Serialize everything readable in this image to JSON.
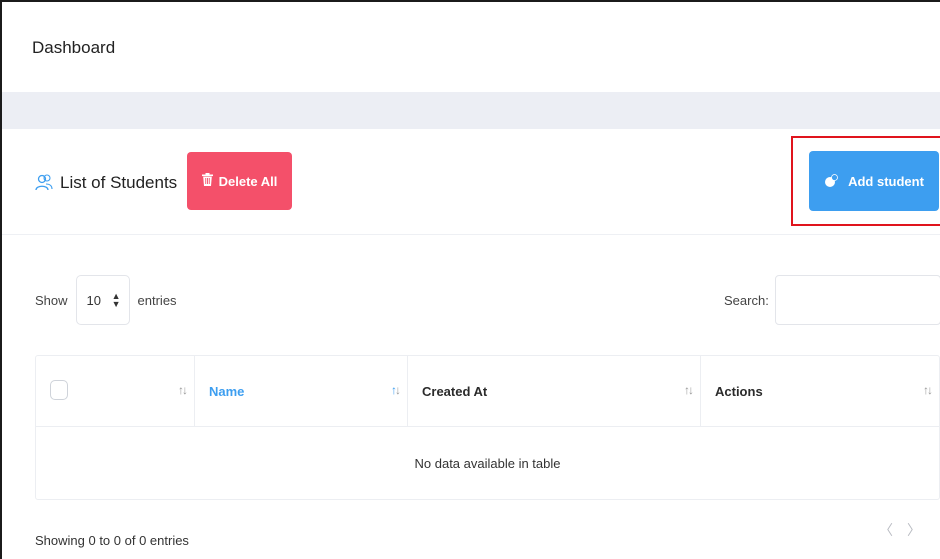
{
  "header": {
    "title": "Dashboard"
  },
  "card": {
    "title": "List of Students",
    "delete_all_label": "Delete All",
    "add_student_label": "Add student"
  },
  "length": {
    "show_label": "Show",
    "selected": "10",
    "entries_label": "entries"
  },
  "search": {
    "label": "Search:",
    "value": ""
  },
  "table": {
    "columns": [
      {
        "label": ""
      },
      {
        "label": "Name"
      },
      {
        "label": "Created At"
      },
      {
        "label": "Actions"
      }
    ],
    "sort_glyph": "↑↓",
    "empty_message": "No data available in table"
  },
  "footer": {
    "info": "Showing 0 to 0 of 0 entries",
    "prev_glyph": "〈",
    "next_glyph": "〉"
  },
  "colors": {
    "delete_button": "#f4506a",
    "add_button": "#3d9ef0",
    "highlight_box": "#e0141d",
    "active_sort": "#3d9ef0"
  },
  "icons": {
    "title_icon": "users-icon",
    "delete_icon": "trash-icon",
    "add_icon": "user-plus-icon"
  }
}
